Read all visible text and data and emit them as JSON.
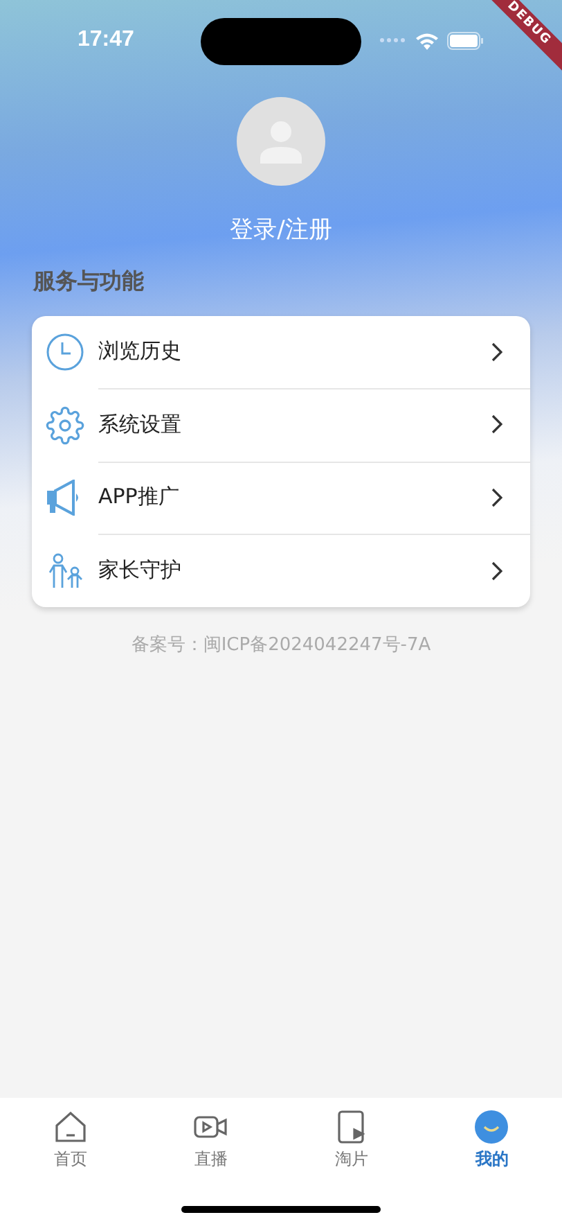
{
  "status_bar": {
    "time": "17:47"
  },
  "debug_banner": "DEBUG",
  "profile": {
    "login_label": "登录/注册"
  },
  "section_title": "服务与功能",
  "menu": [
    {
      "kind": "history",
      "label": "浏览历史"
    },
    {
      "kind": "settings",
      "label": "系统设置"
    },
    {
      "kind": "promote",
      "label": "APP推广"
    },
    {
      "kind": "parental",
      "label": "家长守护"
    }
  ],
  "footer": "备案号：闽ICP备2024042247号-7A",
  "tabs": [
    {
      "kind": "home",
      "label": "首页",
      "selected": false
    },
    {
      "kind": "live",
      "label": "直播",
      "selected": false
    },
    {
      "kind": "clips",
      "label": "淘片",
      "selected": false
    },
    {
      "kind": "mine",
      "label": "我的",
      "selected": true
    }
  ]
}
